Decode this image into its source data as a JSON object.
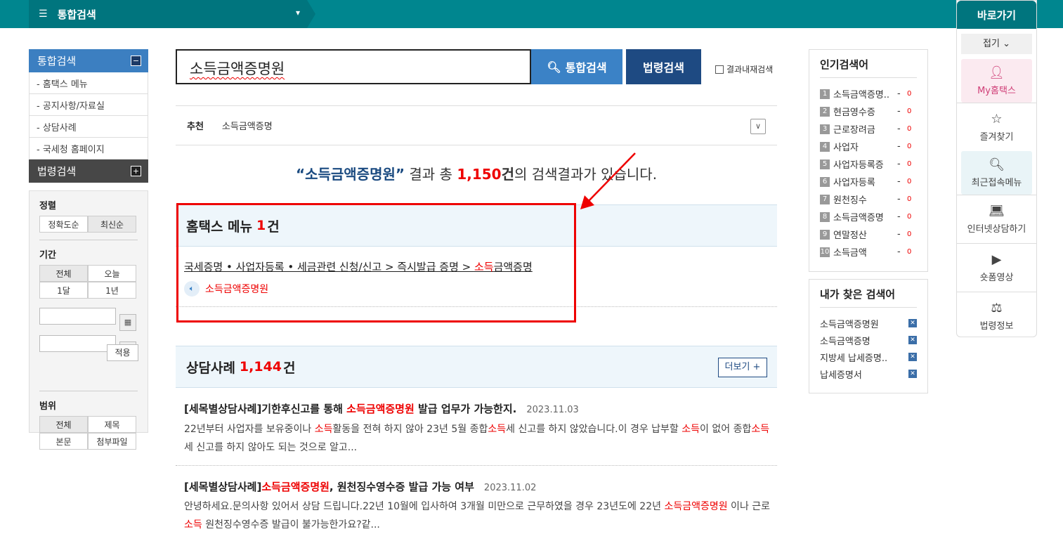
{
  "topbar": {
    "menu_label": "통합검색"
  },
  "left_nav": {
    "integrated": "통합검색",
    "items": [
      "- 홈택스 메뉴",
      "- 공지사항/자료실",
      "- 상담사례",
      "- 국세청 홈페이지"
    ],
    "law": "법령검색"
  },
  "filter": {
    "sort_label": "정렬",
    "sort_opts": [
      "정확도순",
      "최신순"
    ],
    "period_label": "기간",
    "period_opts": [
      "전체",
      "오늘",
      "1달",
      "1년"
    ],
    "apply": "적용",
    "scope_label": "범위",
    "scope_opts": [
      "전체",
      "제목",
      "본문",
      "첨부파일"
    ]
  },
  "search": {
    "query": "소득금액증명원",
    "btn_integrated": "통합검색",
    "btn_law": "법령검색",
    "within": "결과내재검색"
  },
  "recommend": {
    "label": "추천",
    "term": "소득금액증명"
  },
  "summary": {
    "quote": "“소득금액증명원”",
    "mid": " 결과 총 ",
    "count": "1,150",
    "unit": "건",
    "tail": "의 검색결과가 있습니다."
  },
  "hometax": {
    "title": "홈택스 메뉴",
    "count": "1",
    "unit": "건",
    "path_a": "국세증명 • 사업자등록 • 세금관련 신청/신고 > 즉시발급 증명 > ",
    "path_r": "소득",
    "path_b": "금액증명",
    "result": "소득금액증명원"
  },
  "consult": {
    "title": "상담사례",
    "count": "1,144",
    "unit": "건",
    "more": "더보기 +",
    "posts": [
      {
        "t1": "[세목별상담사례]기한후신고를 통해 ",
        "t_r": "소득금액증명원",
        "t2": " 발급 업무가 가능한지.",
        "date": "2023.11.03",
        "b1": "22년부터 사업자를 보유중이나 ",
        "r1": "소득",
        "b2": "활동을 전혀 하지 않아 23년 5월 종합",
        "r2": "소득",
        "b3": "세 신고를 하지 않았습니다.이 경우 납부할 ",
        "r3": "소득",
        "b4": "이 없어 종합",
        "r4": "소득",
        "b5": "세 신고를 하지 않아도 되는 것으로 알고..."
      },
      {
        "t1": "[세목별상담사례]",
        "t_r": "소득금액증명원",
        "t2": ", 원천징수영수증 발급 가능 여부",
        "date": "2023.11.02",
        "b1": "안녕하세요.문의사항 있어서 상담 드립니다.22년 10월에 입사하여 3개월 미만으로 근무하였을 경우 23년도에 22년 ",
        "r1": "소득금액증명원",
        "b2": " 이나 근로",
        "r2": "소득",
        "b3": " 원천징수영수증 발급이 불가능한가요?같..."
      }
    ]
  },
  "popular": {
    "title": "인기검색어",
    "items": [
      {
        "n": "1",
        "t": "소득금액증명.."
      },
      {
        "n": "2",
        "t": "현금영수증"
      },
      {
        "n": "3",
        "t": "근로장려금"
      },
      {
        "n": "4",
        "t": "사업자"
      },
      {
        "n": "5",
        "t": "사업자등록증"
      },
      {
        "n": "6",
        "t": "사업자등록"
      },
      {
        "n": "7",
        "t": "원천징수"
      },
      {
        "n": "8",
        "t": "소득금액증명"
      },
      {
        "n": "9",
        "t": "연말정산"
      },
      {
        "n": "10",
        "t": "소득금액"
      }
    ],
    "dash": "-",
    "zero": "0"
  },
  "mine": {
    "title": "내가 찾은 검색어",
    "items": [
      "소득금액증명원",
      "소득금액증명",
      "지방세 납세증명..",
      "납세증명서"
    ]
  },
  "quick": {
    "title": "바로가기",
    "fold": "접기",
    "items": [
      "My홈택스",
      "즐겨찾기",
      "최근접속메뉴",
      "인터넷상담하기",
      "숏폼영상",
      "법령정보"
    ]
  }
}
